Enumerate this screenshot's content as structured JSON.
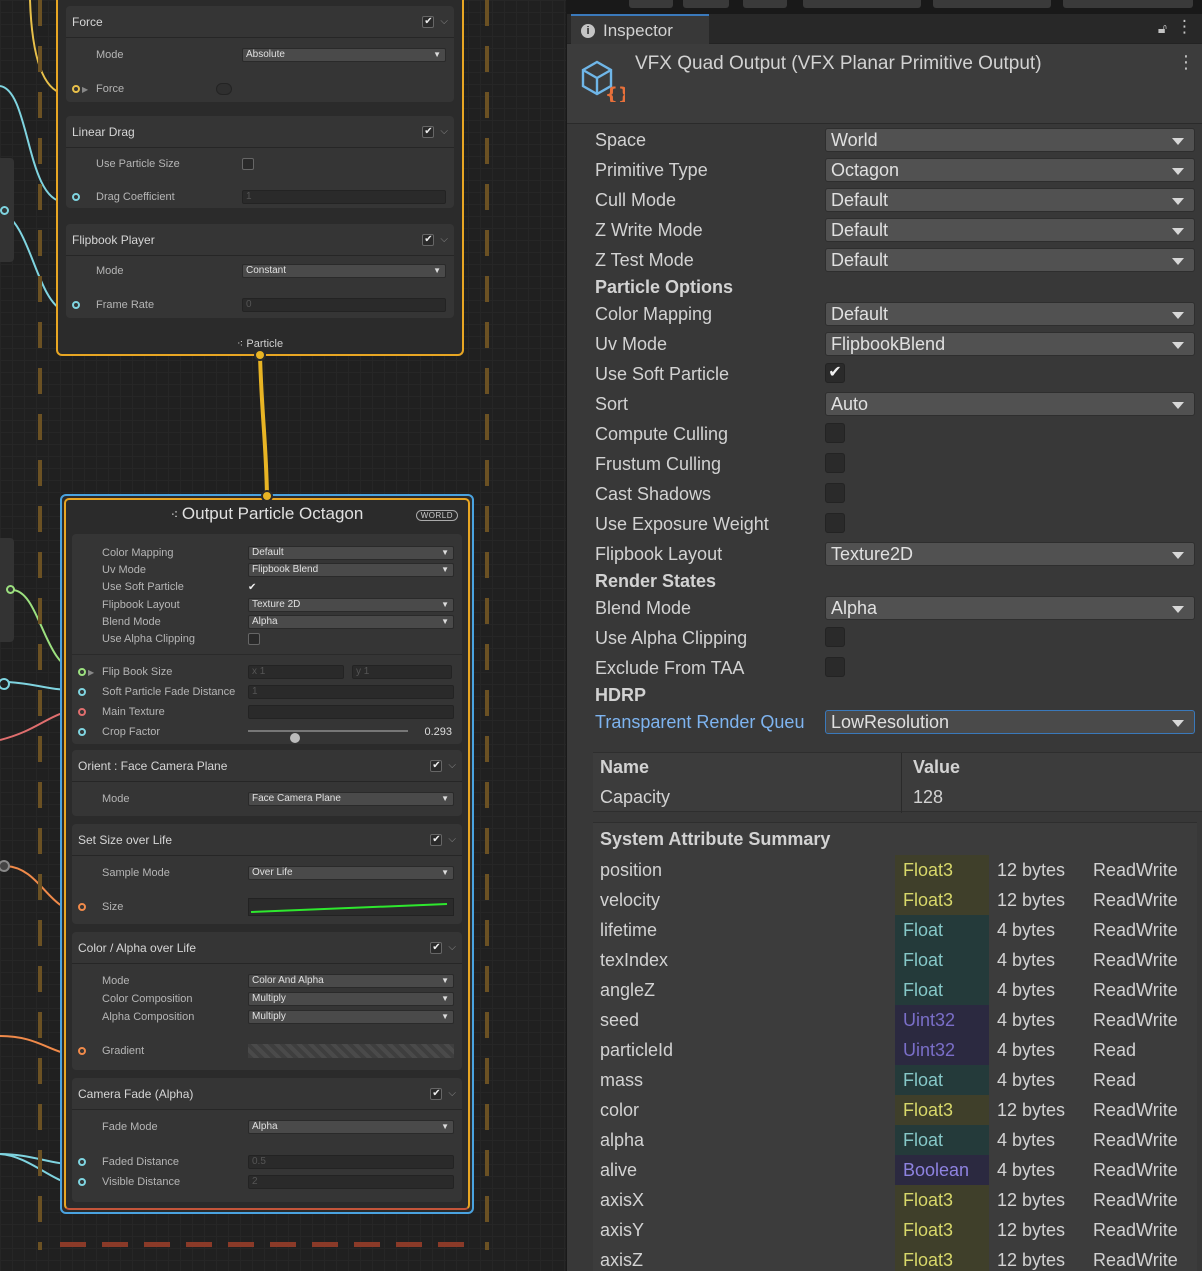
{
  "graph": {
    "update_blocks": [
      {
        "title": "Force",
        "rows": [
          {
            "label": "Mode",
            "value": "Absolute"
          },
          {
            "label": "Force",
            "value": ""
          }
        ]
      },
      {
        "title": "Linear Drag",
        "rows": [
          {
            "label": "Use Particle Size",
            "value": ""
          },
          {
            "label": "Drag Coefficient",
            "value": "1"
          }
        ]
      },
      {
        "title": "Flipbook Player",
        "rows": [
          {
            "label": "Mode",
            "value": "Constant"
          },
          {
            "label": "Frame Rate",
            "value": "0"
          }
        ]
      }
    ],
    "update_footer": "Particle",
    "output": {
      "title": "Output Particle Octagon",
      "badge": "WORLD",
      "settings": [
        {
          "label": "Color Mapping",
          "value": "Default"
        },
        {
          "label": "Uv Mode",
          "value": "Flipbook Blend"
        },
        {
          "label": "Use Soft Particle",
          "value": "✔"
        },
        {
          "label": "Flipbook Layout",
          "value": "Texture 2D"
        },
        {
          "label": "Blend Mode",
          "value": "Alpha"
        },
        {
          "label": "Use Alpha Clipping",
          "value": ""
        }
      ],
      "inputs": [
        {
          "label": "Flip Book Size",
          "x": "x 1",
          "y": "y 1"
        },
        {
          "label": "Soft Particle Fade Distance",
          "value": "1"
        },
        {
          "label": "Main Texture",
          "value": ""
        },
        {
          "label": "Crop Factor",
          "value": "0.293",
          "level": 0.293
        }
      ],
      "blocks": [
        {
          "title": "Orient : Face Camera Plane",
          "rows": [
            {
              "label": "Mode",
              "value": "Face Camera Plane"
            }
          ]
        },
        {
          "title": "Set Size over Life",
          "rows": [
            {
              "label": "Sample Mode",
              "value": "Over Life"
            },
            {
              "label": "Size",
              "value": ""
            }
          ]
        },
        {
          "title": "Color / Alpha over Life",
          "rows": [
            {
              "label": "Mode",
              "value": "Color And Alpha"
            },
            {
              "label": "Color Composition",
              "value": "Multiply"
            },
            {
              "label": "Alpha Composition",
              "value": "Multiply"
            },
            {
              "label": "Gradient",
              "value": ""
            }
          ]
        },
        {
          "title": "Camera Fade (Alpha)",
          "rows": [
            {
              "label": "Fade Mode",
              "value": "Alpha"
            },
            {
              "label": "Faded Distance",
              "value": "0.5"
            },
            {
              "label": "Visible Distance",
              "value": "2"
            }
          ]
        }
      ]
    }
  },
  "inspector": {
    "tab_label": "Inspector",
    "info_icon": "i",
    "title": "VFX Quad Output (VFX Planar Primitive Output)",
    "properties": [
      {
        "label": "Space",
        "type": "dropdown",
        "value": "World"
      },
      {
        "label": "Primitive Type",
        "type": "dropdown",
        "value": "Octagon"
      },
      {
        "label": "Cull Mode",
        "type": "dropdown",
        "value": "Default"
      },
      {
        "label": "Z Write Mode",
        "type": "dropdown",
        "value": "Default"
      },
      {
        "label": "Z Test Mode",
        "type": "dropdown",
        "value": "Default"
      }
    ],
    "particle_options_header": "Particle Options",
    "particle_options": [
      {
        "label": "Color Mapping",
        "type": "dropdown",
        "value": "Default"
      },
      {
        "label": "Uv Mode",
        "type": "dropdown",
        "value": "FlipbookBlend"
      },
      {
        "label": "Use Soft Particle",
        "type": "checkbox",
        "value": "✔"
      },
      {
        "label": "Sort",
        "type": "dropdown",
        "value": "Auto"
      },
      {
        "label": "Compute Culling",
        "type": "checkbox",
        "value": ""
      },
      {
        "label": "Frustum Culling",
        "type": "checkbox",
        "value": ""
      },
      {
        "label": "Cast Shadows",
        "type": "checkbox",
        "value": ""
      },
      {
        "label": "Use Exposure Weight",
        "type": "checkbox",
        "value": ""
      },
      {
        "label": "Flipbook Layout",
        "type": "dropdown",
        "value": "Texture2D"
      }
    ],
    "render_states_header": "Render States",
    "render_states": [
      {
        "label": "Blend Mode",
        "type": "dropdown",
        "value": "Alpha"
      },
      {
        "label": "Use Alpha Clipping",
        "type": "checkbox",
        "value": ""
      },
      {
        "label": "Exclude From TAA",
        "type": "checkbox",
        "value": ""
      }
    ],
    "hdrp_header": "HDRP",
    "hdrp": [
      {
        "label": "Transparent Render Queu",
        "type": "dropdown",
        "value": "LowResolution"
      }
    ],
    "capacity_table": {
      "name_header": "Name",
      "value_header": "Value",
      "name": "Capacity",
      "value": "128"
    },
    "attr_summary_title": "System Attribute Summary",
    "attributes": [
      {
        "name": "position",
        "type": "Float3",
        "size": "12 bytes",
        "access": "ReadWrite"
      },
      {
        "name": "velocity",
        "type": "Float3",
        "size": "12 bytes",
        "access": "ReadWrite"
      },
      {
        "name": "lifetime",
        "type": "Float",
        "size": "4 bytes",
        "access": "ReadWrite"
      },
      {
        "name": "texIndex",
        "type": "Float",
        "size": "4 bytes",
        "access": "ReadWrite"
      },
      {
        "name": "angleZ",
        "type": "Float",
        "size": "4 bytes",
        "access": "ReadWrite"
      },
      {
        "name": "seed",
        "type": "Uint32",
        "size": "4 bytes",
        "access": "ReadWrite"
      },
      {
        "name": "particleId",
        "type": "Uint32",
        "size": "4 bytes",
        "access": "Read"
      },
      {
        "name": "mass",
        "type": "Float",
        "size": "4 bytes",
        "access": "Read"
      },
      {
        "name": "color",
        "type": "Float3",
        "size": "12 bytes",
        "access": "ReadWrite"
      },
      {
        "name": "alpha",
        "type": "Float",
        "size": "4 bytes",
        "access": "ReadWrite"
      },
      {
        "name": "alive",
        "type": "Boolean",
        "size": "4 bytes",
        "access": "ReadWrite"
      },
      {
        "name": "axisX",
        "type": "Float3",
        "size": "12 bytes",
        "access": "ReadWrite"
      },
      {
        "name": "axisY",
        "type": "Float3",
        "size": "12 bytes",
        "access": "ReadWrite"
      },
      {
        "name": "axisZ",
        "type": "Float3",
        "size": "12 bytes",
        "access": "ReadWrite"
      }
    ],
    "type_colors": {
      "Float3": {
        "bg": "#3f3f2a",
        "fg": "#d8d86a"
      },
      "Float": {
        "bg": "#243a3a",
        "fg": "#86c8c8"
      },
      "Uint32": {
        "bg": "#2b2940",
        "fg": "#7a6ec8"
      },
      "Boolean": {
        "bg": "#2b2940",
        "fg": "#8e82e0"
      }
    }
  }
}
